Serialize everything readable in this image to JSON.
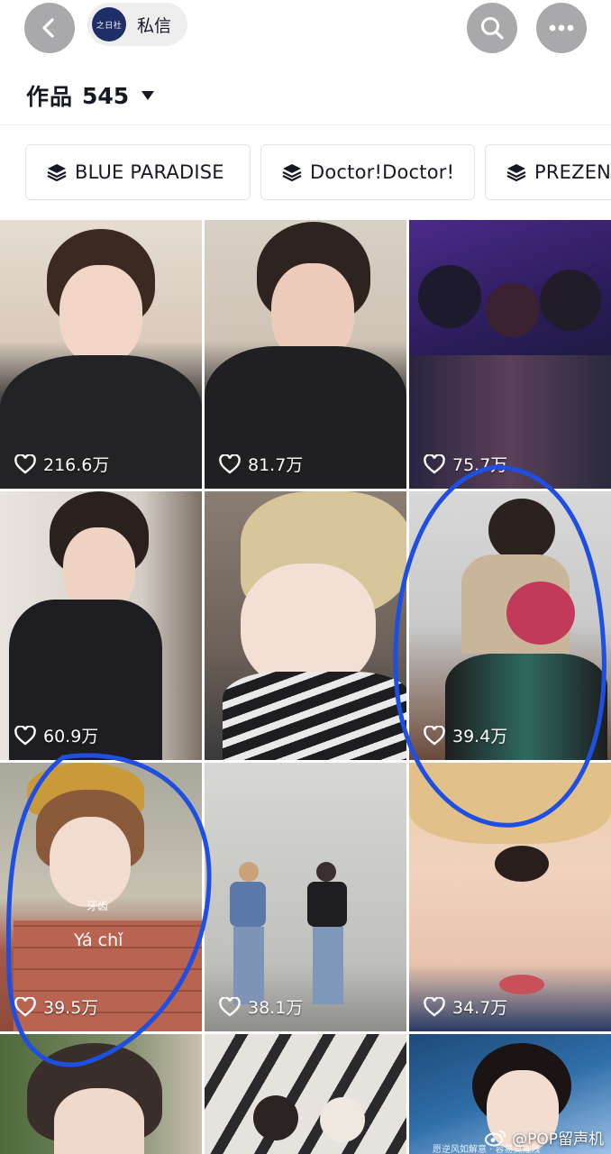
{
  "topbar": {
    "chip_avatar_text": "之日社",
    "chip_label": "私信"
  },
  "works": {
    "label": "作品",
    "count": "545"
  },
  "collections": [
    {
      "label": "BLUE PARADISE",
      "icon": "layers-icon"
    },
    {
      "label": "Doctor!Doctor!",
      "icon": "layers-icon"
    },
    {
      "label": "PREZEN",
      "icon": "layers-icon"
    }
  ],
  "videos": [
    {
      "likes": "216.6万"
    },
    {
      "likes": "81.7万"
    },
    {
      "likes": "75.7万"
    },
    {
      "likes": "60.9万"
    },
    {
      "likes": ""
    },
    {
      "likes": "39.4万"
    },
    {
      "likes": "39.5万",
      "sticker_small": "牙齿",
      "sticker_big": "Yá chǐ"
    },
    {
      "likes": "38.1万"
    },
    {
      "likes": "34.7万"
    },
    {
      "likes": ""
    },
    {
      "likes": ""
    },
    {
      "likes": ""
    }
  ],
  "watermark": {
    "text": "@POP留声机",
    "sub": "愿逆风如解意 · 容易莫摧残"
  },
  "colors": {
    "annotation_circle": "#1f4fe0",
    "button_gray": "#a9a9ab"
  }
}
